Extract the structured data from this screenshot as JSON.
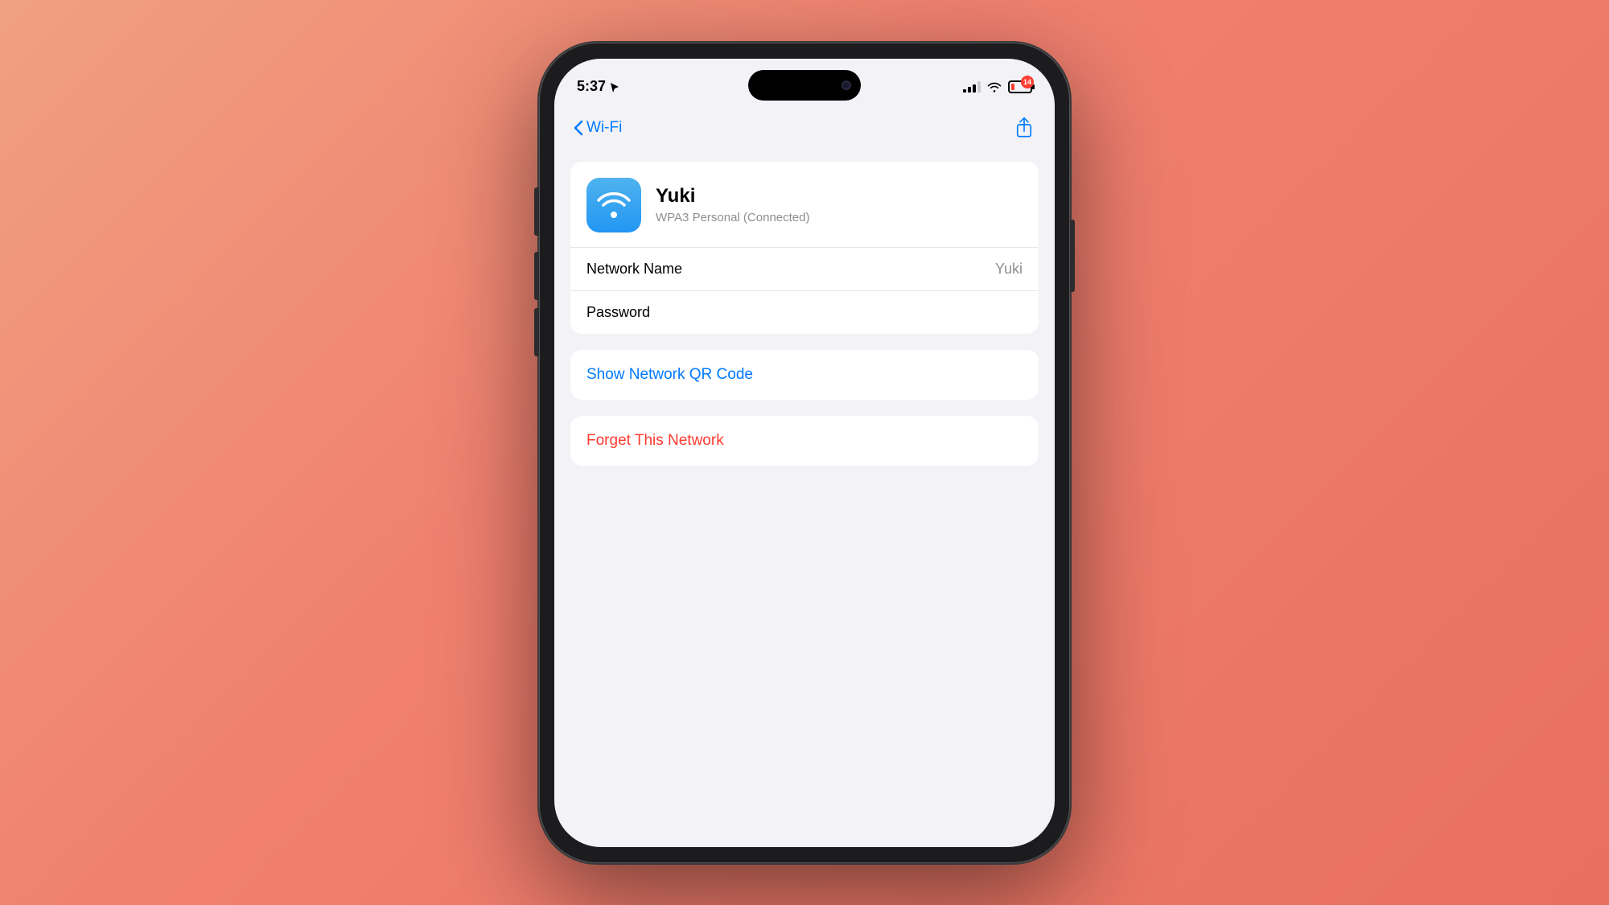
{
  "background": {
    "gradient_start": "#f0a080",
    "gradient_end": "#e87060"
  },
  "status_bar": {
    "time": "5:37",
    "battery_level": 14,
    "battery_color": "#ff3b30"
  },
  "nav": {
    "back_label": "Wi-Fi",
    "share_icon": "share-icon"
  },
  "network": {
    "name": "Yuki",
    "security": "WPA3 Personal (Connected)",
    "network_name_label": "Network Name",
    "network_name_value": "Yuki",
    "password_label": "Password"
  },
  "actions": {
    "qr_code_label": "Show Network QR Code",
    "forget_label": "Forget This Network"
  }
}
